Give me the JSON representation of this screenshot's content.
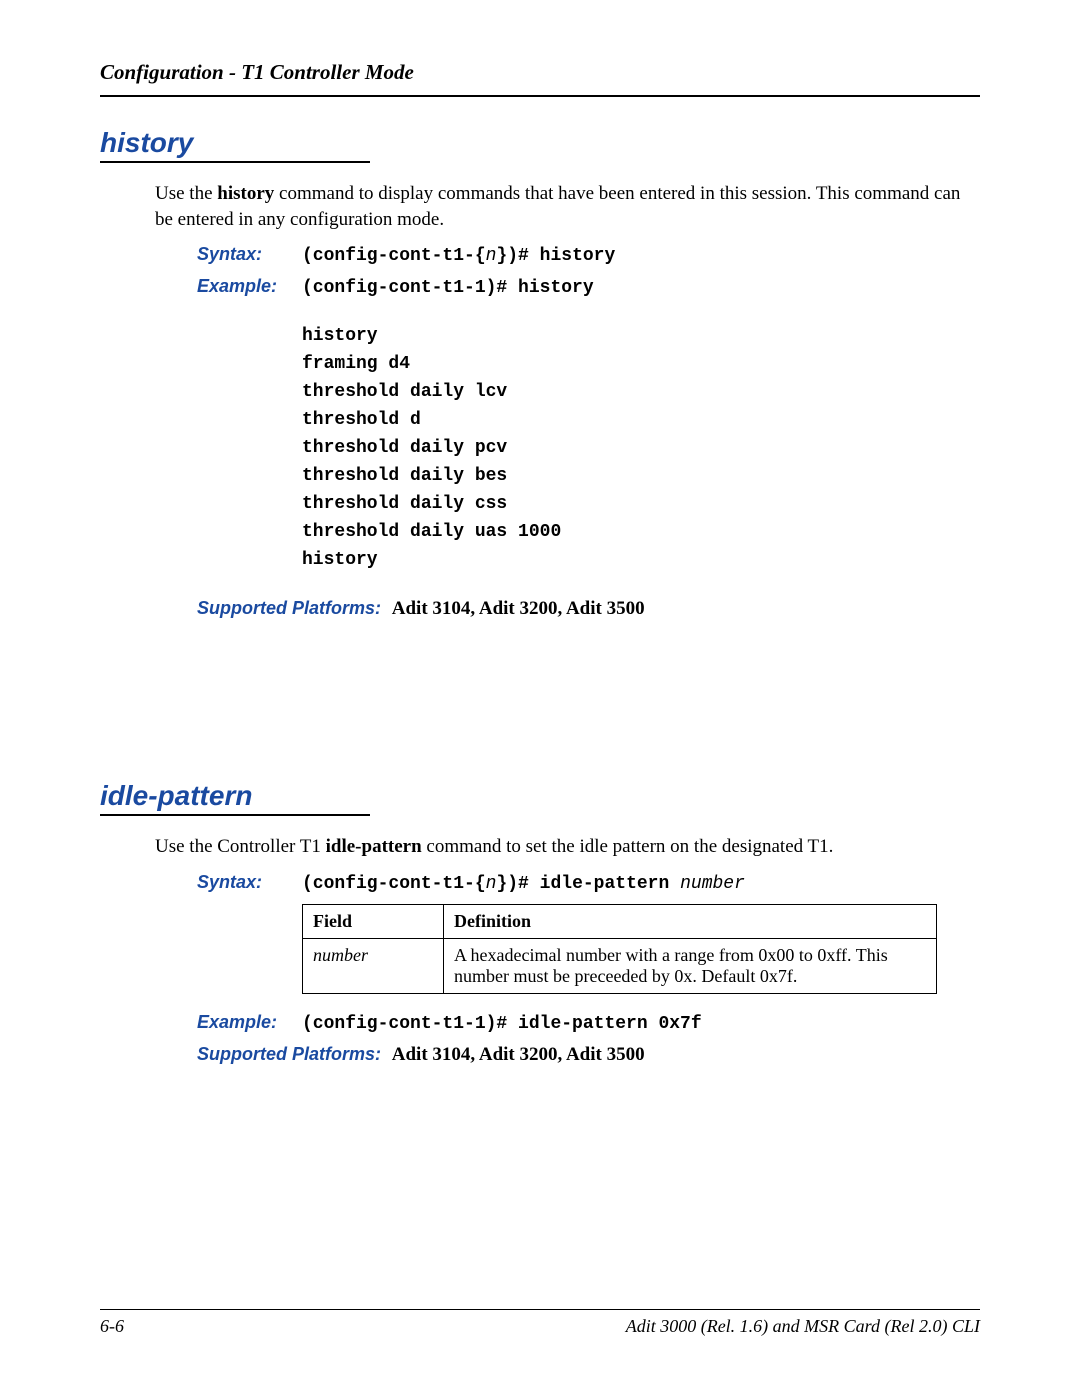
{
  "running_head": "Configuration - T1 Controller Mode",
  "sections": {
    "history": {
      "title": "history",
      "intro_pre": "Use the ",
      "intro_bold": "history",
      "intro_post": " command to display commands that have been entered in this session.  This command can be entered in any configuration mode.",
      "syntax_label": "Syntax:",
      "syntax_pre": "(config-cont-t1-{",
      "syntax_var": "n",
      "syntax_post": "})# history",
      "example_label": "Example:",
      "example_text": "(config-cont-t1-1)# history",
      "output": [
        "history",
        "framing d4",
        "threshold daily lcv",
        "threshold d",
        "threshold daily pcv",
        "threshold daily bes",
        "threshold daily css",
        "threshold daily uas 1000",
        "history"
      ],
      "supported_label": "Supported Platforms:",
      "supported_value": "Adit 3104, Adit 3200, Adit 3500"
    },
    "idle": {
      "title": "idle-pattern",
      "intro_pre": "Use the Controller T1 ",
      "intro_bold": "idle-pattern",
      "intro_post": " command to set the idle pattern on the designated T1.",
      "syntax_label": "Syntax:",
      "syntax_pre": "(config-cont-t1-{",
      "syntax_var": "n",
      "syntax_post": "})# idle-pattern ",
      "syntax_arg": "number",
      "table": {
        "head_field": "Field",
        "head_def": "Definition",
        "row_field": "number",
        "row_def": "A hexadecimal number with a range from 0x00 to 0xff. This number must be preceeded by 0x. Default 0x7f."
      },
      "example_label": "Example:",
      "example_text": "(config-cont-t1-1)# idle-pattern 0x7f",
      "supported_label": "Supported Platforms:",
      "supported_value": "Adit 3104, Adit 3200, Adit 3500"
    }
  },
  "footer": {
    "page": "6-6",
    "doc": "Adit 3000 (Rel. 1.6) and MSR Card (Rel 2.0) CLI"
  }
}
